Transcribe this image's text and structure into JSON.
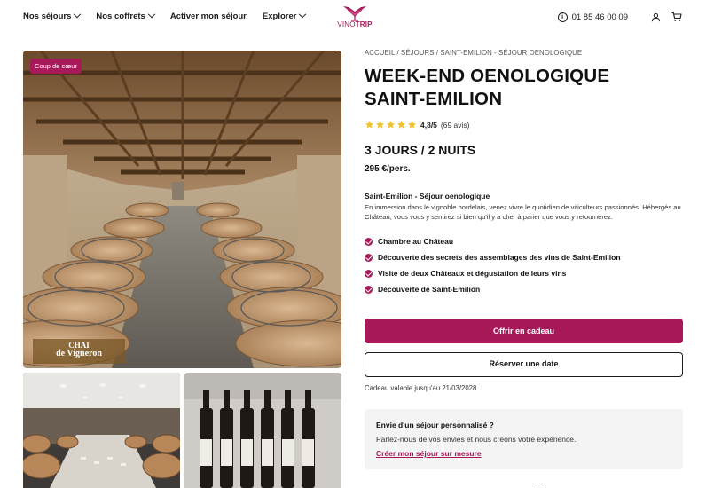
{
  "header": {
    "nav": [
      {
        "label": "Nos séjours",
        "dropdown": true
      },
      {
        "label": "Nos coffrets",
        "dropdown": true
      },
      {
        "label": "Activer mon séjour",
        "dropdown": false
      },
      {
        "label": "Explorer",
        "dropdown": true
      }
    ],
    "logo": {
      "part1": "VINO",
      "part2": "TRIP"
    },
    "phone": "01 85 46 00 09",
    "icons": [
      "info-icon",
      "user-icon",
      "cart-icon"
    ]
  },
  "gallery": {
    "badge": "Coup de cœur",
    "watermark_line1": "CHAI",
    "watermark_line2": "de Vigneron"
  },
  "product": {
    "breadcrumb": [
      "ACCUEIL",
      "SÉJOURS",
      "SAINT-EMILION - SÉJOUR OENOLOGIQUE"
    ],
    "breadcrumb_separator": " / ",
    "title_line1": "WEEK-END OENOLOGIQUE",
    "title_line2": "SAINT-EMILION",
    "rating": 4.8,
    "rating_label": "4,8/5",
    "rating_count": "(69 avis)",
    "stars": 5,
    "duration": "3 JOURS / 2 NUITS",
    "price": "295 €/pers.",
    "subtitle": "Saint-Emilion - Séjour oenologique",
    "description": "En immersion dans le vignoble bordelais, venez vivre le quotidien de viticulteurs passionnés. Hébergés au Château, vous vous y sentirez si bien qu'il y a cher à parier que vous y retournerez.",
    "features": [
      "Chambre au Château",
      "Découverte des secrets des assemblages des vins de Saint-Emilion",
      "Visite de deux Châteaux et dégustation de leurs vins",
      "Découverte de Saint-Emilion"
    ],
    "gift_button": "Offrir en cadeau",
    "book_button": "Réserver une date",
    "validity": "Cadeau valable jusqu'au 21/03/2028"
  },
  "custom": {
    "title": "Envie d'un séjour personnalisé ?",
    "text": "Parlez-nous de vos envies et nous créons votre expérience.",
    "link": "Créer mon séjour sur mesure"
  },
  "colors": {
    "accent": "#a8195a",
    "star": "#f2c12e",
    "text": "#1b1b1b",
    "panel": "#f4f4f4"
  }
}
